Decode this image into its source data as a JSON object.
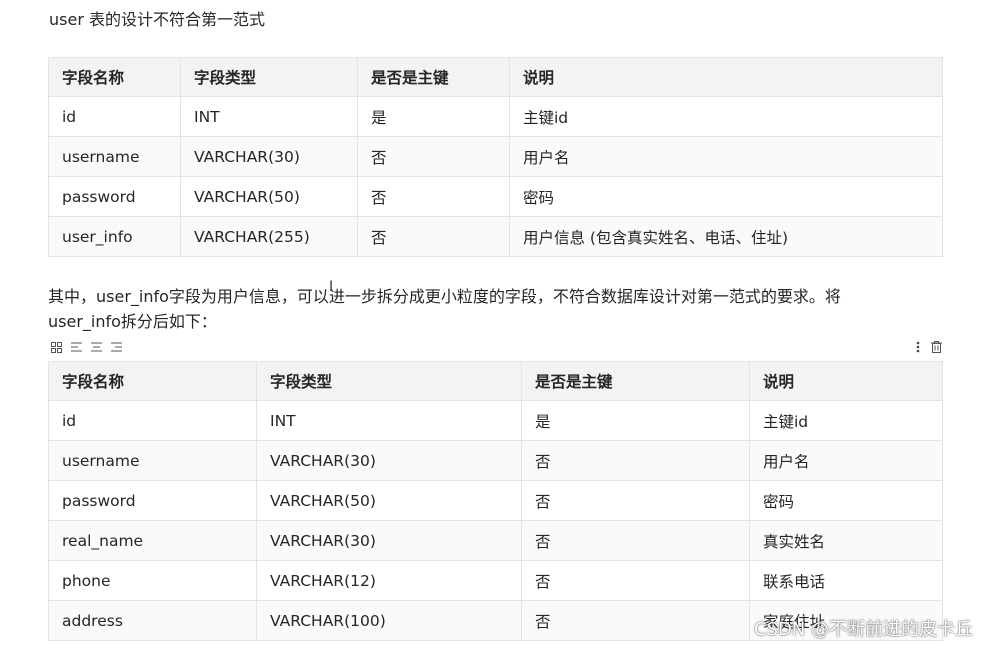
{
  "intro": "user 表的设计不符合第一范式",
  "table1": {
    "headers": [
      "字段名称",
      "字段类型",
      "是否是主键",
      "说明"
    ],
    "rows": [
      [
        "id",
        "INT",
        "是",
        "主键id"
      ],
      [
        "username",
        "VARCHAR(30)",
        "否",
        "用户名"
      ],
      [
        "password",
        "VARCHAR(50)",
        "否",
        "密码"
      ],
      [
        "user_info",
        "VARCHAR(255)",
        "否",
        "用户信息 (包含真实姓名、电话、住址)"
      ]
    ]
  },
  "paragraph": {
    "line1": "其中，user_info字段为用户信息，可以进一步拆分成更小粒度的字段，不符合数据库设计对第一范式的要求。将",
    "line2": "user_info拆分后如下："
  },
  "toolbar": {
    "left_icons": [
      "grid-icon",
      "align-left-icon",
      "align-center-icon",
      "align-right-icon"
    ],
    "right_icons": [
      "more-icon",
      "delete-icon"
    ]
  },
  "table2": {
    "headers": [
      "字段名称",
      "字段类型",
      "是否是主键",
      "说明"
    ],
    "rows": [
      [
        "id",
        "INT",
        "是",
        "主键id"
      ],
      [
        "username",
        "VARCHAR(30)",
        "否",
        "用户名"
      ],
      [
        "password",
        "VARCHAR(50)",
        "否",
        "密码"
      ],
      [
        "real_name",
        "VARCHAR(30)",
        "否",
        "真实姓名"
      ],
      [
        "phone",
        "VARCHAR(12)",
        "否",
        "联系电话"
      ],
      [
        "address",
        "VARCHAR(100)",
        "否",
        "家庭住址"
      ]
    ]
  },
  "watermark": "CSDN @不断前进的皮卡丘"
}
